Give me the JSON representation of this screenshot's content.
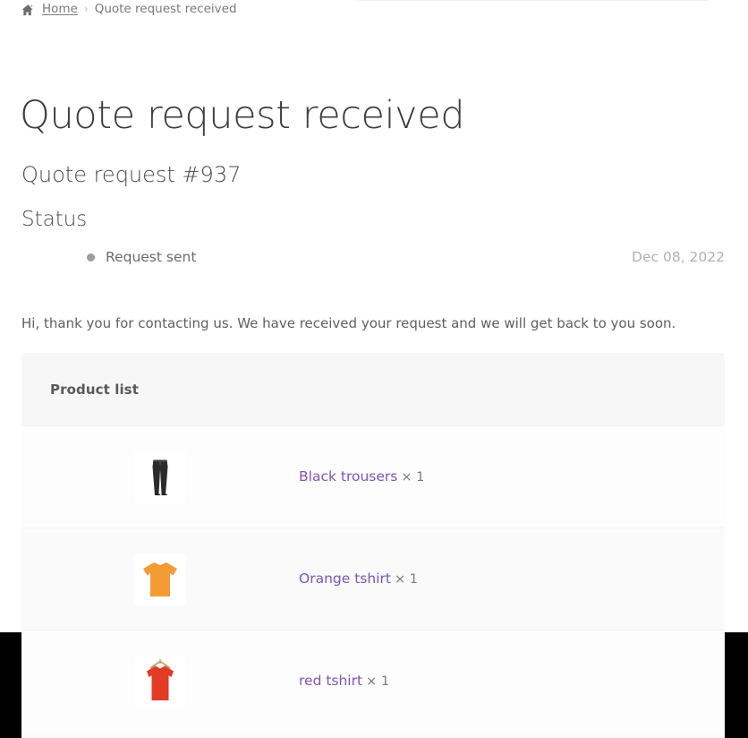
{
  "breadcrumb": {
    "home_icon": "home-icon",
    "home_label": "Home",
    "separator": "›",
    "current": "Quote request received"
  },
  "page": {
    "title": "Quote request received",
    "order_number": "Quote request #937",
    "status_heading": "Status",
    "intro_text": "Hi, thank you for contacting us. We have received your request and we will get back to you soon."
  },
  "status": {
    "label": "Request sent",
    "date": "Dec 08, 2022",
    "dot_color": "#9c9c9c"
  },
  "product_table": {
    "header_label": "Product list",
    "rows": [
      {
        "thumb_icon": "black-trousers-thumbnail",
        "name": "Black trousers",
        "quantity": "× 1",
        "color": "#2b2b2b"
      },
      {
        "thumb_icon": "orange-tshirt-thumbnail",
        "name": "Orange tshirt",
        "quantity": "× 1",
        "color": "#f39c35"
      },
      {
        "thumb_icon": "red-tshirt-thumbnail",
        "name": "red tshirt",
        "quantity": "× 1",
        "color": "#e23b26"
      }
    ]
  },
  "theme": {
    "link_color": "#7f54b3",
    "header_band": "#f7f7f7",
    "text_color": "#5f5f5f"
  }
}
